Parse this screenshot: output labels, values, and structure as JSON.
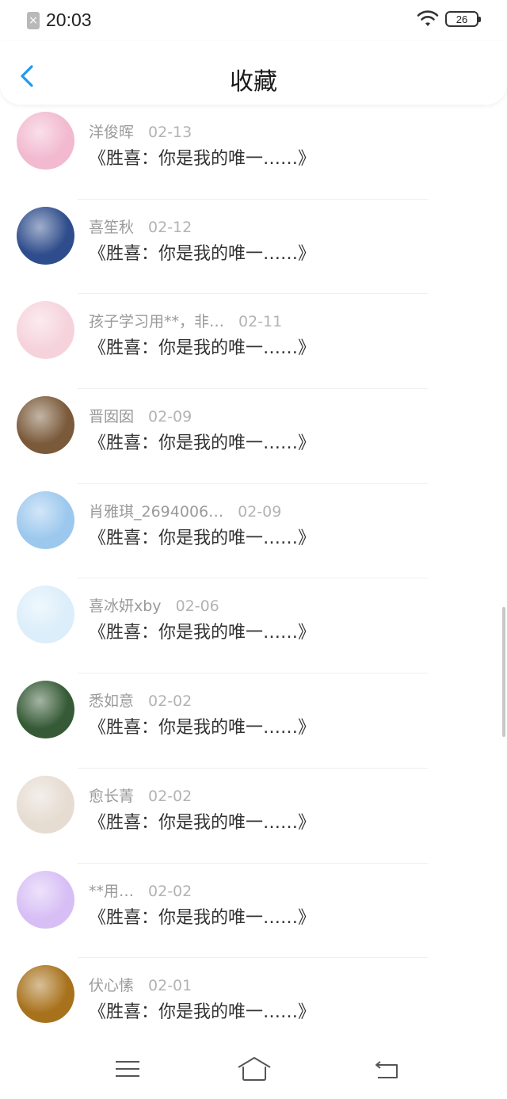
{
  "status": {
    "time": "20:03",
    "battery": "26"
  },
  "nav": {
    "title": "收藏"
  },
  "items": [
    {
      "name": "洋俊晖",
      "date": "02-13",
      "content": "《胜喜：你是我的唯一……》",
      "avatar_color": "#f2b9cf"
    },
    {
      "name": "喜笙秋",
      "date": "02-12",
      "content": "《胜喜：你是我的唯一……》",
      "avatar_color": "#2f4d8c"
    },
    {
      "name": "孩子学习用**，非…",
      "date": "02-11",
      "content": "《胜喜：你是我的唯一……》",
      "avatar_color": "#f6d3dc"
    },
    {
      "name": "晋囡囡",
      "date": "02-09",
      "content": "《胜喜：你是我的唯一……》",
      "avatar_color": "#7a5a3a"
    },
    {
      "name": "肖雅琪_2694006…",
      "date": "02-09",
      "content": "《胜喜：你是我的唯一……》",
      "avatar_color": "#9cc8ee"
    },
    {
      "name": "喜冰妍xby",
      "date": "02-06",
      "content": "《胜喜：你是我的唯一……》",
      "avatar_color": "#dbeefa"
    },
    {
      "name": "悉如意",
      "date": "02-02",
      "content": "《胜喜：你是我的唯一……》",
      "avatar_color": "#355a35"
    },
    {
      "name": "愈长菁",
      "date": "02-02",
      "content": "《胜喜：你是我的唯一……》",
      "avatar_color": "#e6dcd2"
    },
    {
      "name": "**用…",
      "date": "02-02",
      "content": "《胜喜：你是我的唯一……》",
      "avatar_color": "#d7bff5"
    },
    {
      "name": "伏心愫",
      "date": "02-01",
      "content": "《胜喜：你是我的唯一……》",
      "avatar_color": "#a8721c"
    }
  ],
  "icons": {
    "back": "chevron-left-icon",
    "menu": "menu-icon",
    "home": "home-icon",
    "return": "return-icon"
  },
  "colors": {
    "accent": "#1e9bf0",
    "name_text": "#9a9a9a",
    "date_text": "#b3b3b3",
    "content_text": "#333333"
  }
}
